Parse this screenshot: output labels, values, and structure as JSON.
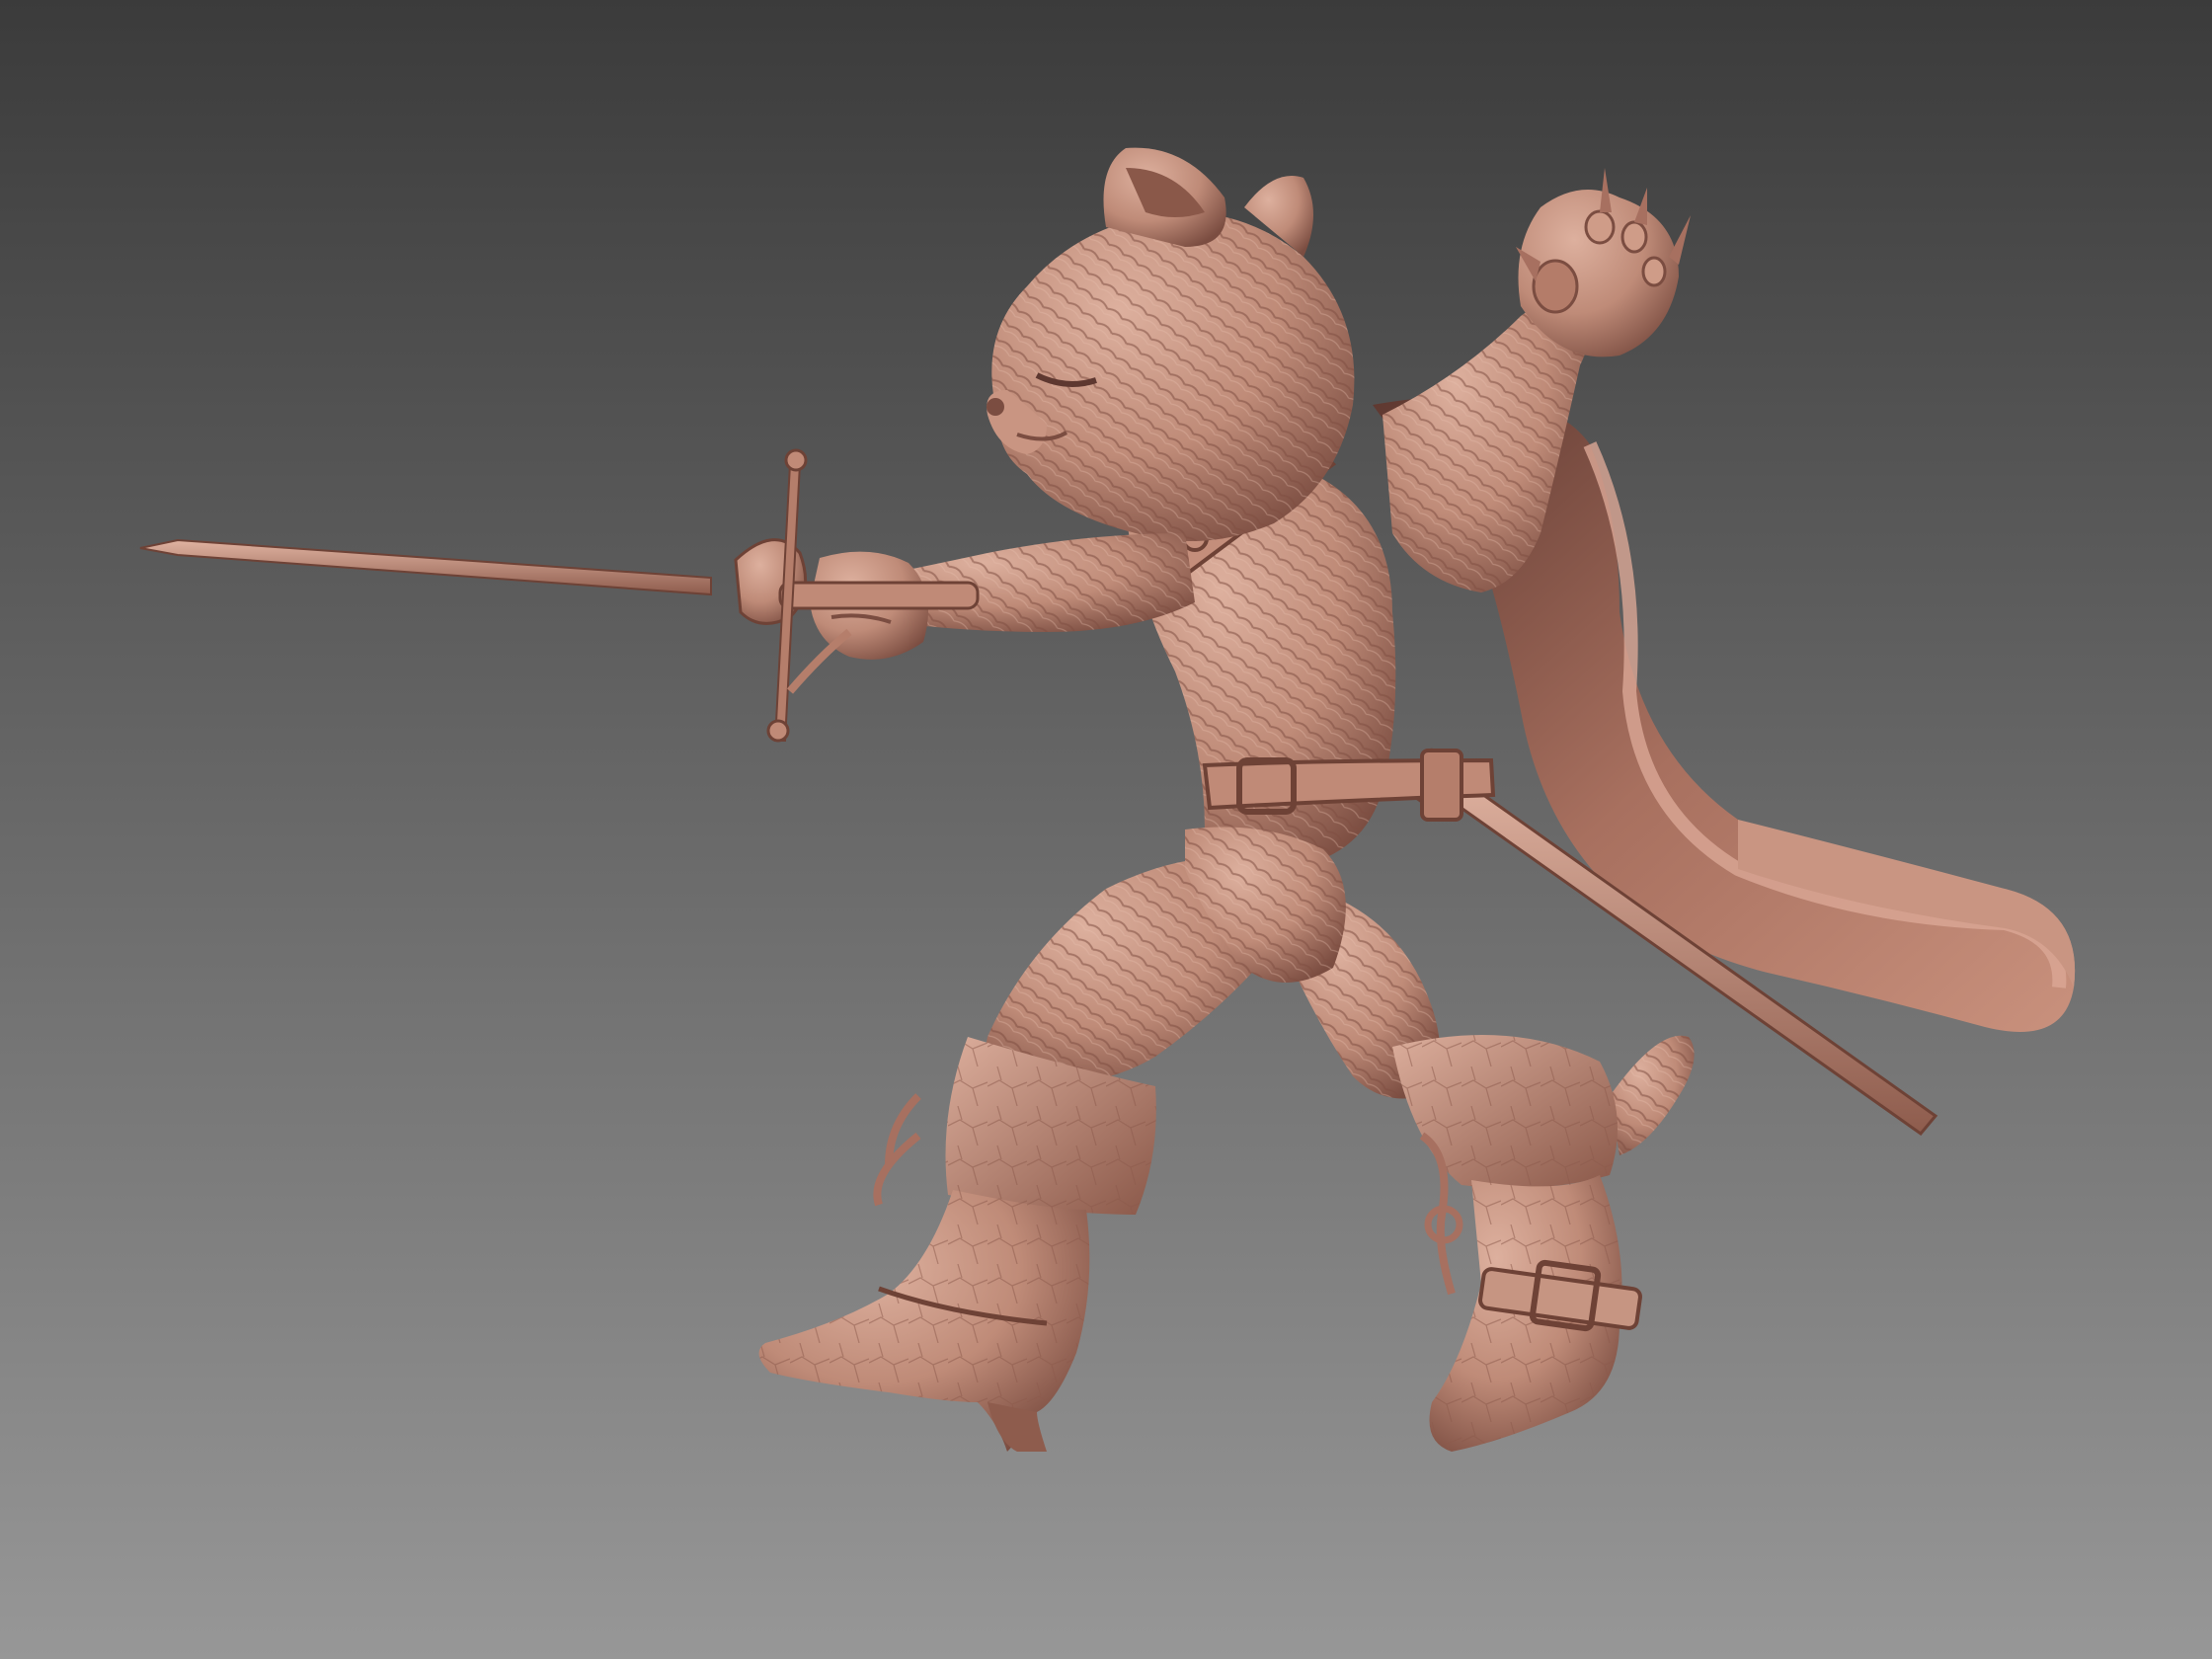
{
  "scene": {
    "subject": "sculpted-cat-musketeer",
    "background_top": "#3b3b3b",
    "background_bottom": "#959595",
    "clay_color": "#c08a77",
    "clay_light": "#e2b4a2",
    "clay_dark": "#7a4c40",
    "clay_shadow": "#5e3830"
  }
}
